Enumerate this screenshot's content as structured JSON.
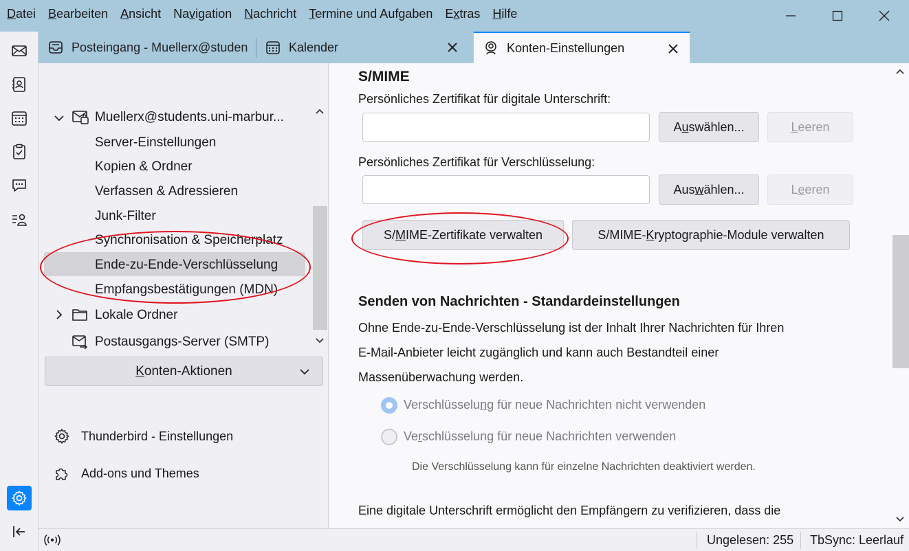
{
  "menu": {
    "items": [
      {
        "pre": "",
        "u": "D",
        "post": "atei"
      },
      {
        "pre": "",
        "u": "B",
        "post": "earbeiten"
      },
      {
        "pre": "",
        "u": "A",
        "post": "nsicht"
      },
      {
        "pre": "Na",
        "u": "v",
        "post": "igation"
      },
      {
        "pre": "",
        "u": "N",
        "post": "achricht"
      },
      {
        "pre": "",
        "u": "T",
        "post": "ermine und Aufgaben"
      },
      {
        "pre": "E",
        "u": "x",
        "post": "tras"
      },
      {
        "pre": "",
        "u": "H",
        "post": "ilfe"
      }
    ]
  },
  "tabs": {
    "inbox": "Posteingang - Muellerx@studen",
    "calendar": "Kalender",
    "account_settings": "Konten-Einstellungen"
  },
  "tree": {
    "account": "Muellerx@students.uni-marbur...",
    "items": [
      "Server-Einstellungen",
      "Kopien & Ordner",
      "Verfassen & Adressieren",
      "Junk-Filter",
      "Synchronisation & Speicherplatz",
      "Ende-zu-Ende-Verschlüsselung",
      "Empfangsbestätigungen (MDN)"
    ],
    "local_folders": "Lokale Ordner",
    "smtp": "Postausgangs-Server (SMTP)",
    "account_actions": {
      "pre": "",
      "u": "K",
      "post": "onten-Aktionen"
    },
    "thunderbird_settings": "Thunderbird - Einstellungen",
    "addons": "Add-ons und Themes"
  },
  "smime": {
    "heading": "S/MIME",
    "sign_label": "Persönliches Zertifikat für digitale Unterschrift:",
    "sign_value": "",
    "enc_label": "Persönliches Zertifikat für Verschlüsselung:",
    "enc_value": "",
    "select1": {
      "pre": "A",
      "u": "u",
      "post": "swählen..."
    },
    "clear1": {
      "pre": "",
      "u": "L",
      "post": "eeren"
    },
    "select2": {
      "pre": "Aus",
      "u": "w",
      "post": "ählen..."
    },
    "clear2": {
      "pre": "L",
      "u": "e",
      "post": "eren"
    },
    "manage_certs": {
      "pre": "S/",
      "u": "M",
      "post": "IME-Zertifikate verwalten"
    },
    "manage_modules": {
      "pre": "S/MIME-",
      "u": "K",
      "post": "ryptographie-Module verwalten"
    }
  },
  "sending": {
    "heading": "Senden von Nachrichten - Standardeinstellungen",
    "desc_lines": [
      "Ohne Ende-zu-Ende-Verschlüsselung ist der Inhalt Ihrer Nachrichten für Ihren",
      "E-Mail-Anbieter leicht zugänglich und kann auch Bestandteil einer",
      "Massenüberwachung werden."
    ],
    "radio_no_enc": {
      "pre": "Verschlüsselu",
      "u": "n",
      "post": "g für neue Nachrichten nicht verwenden"
    },
    "radio_enc": {
      "pre": "Ve",
      "u": "r",
      "post": "schlüsselung für neue Nachrichten verwenden"
    },
    "radio_hint": "Die Verschlüsselung kann für einzelne Nachrichten deaktiviert werden.",
    "signature_text": "Eine digitale Unterschrift ermöglicht den Empfängern zu verifizieren, dass die"
  },
  "status": {
    "unread": "Ungelesen: 255",
    "tbsync": "TbSync: Leerlauf"
  },
  "colors": {
    "titlebar": "#a8c8dc",
    "accent": "#0a84ff",
    "annotation": "#e0141e"
  }
}
